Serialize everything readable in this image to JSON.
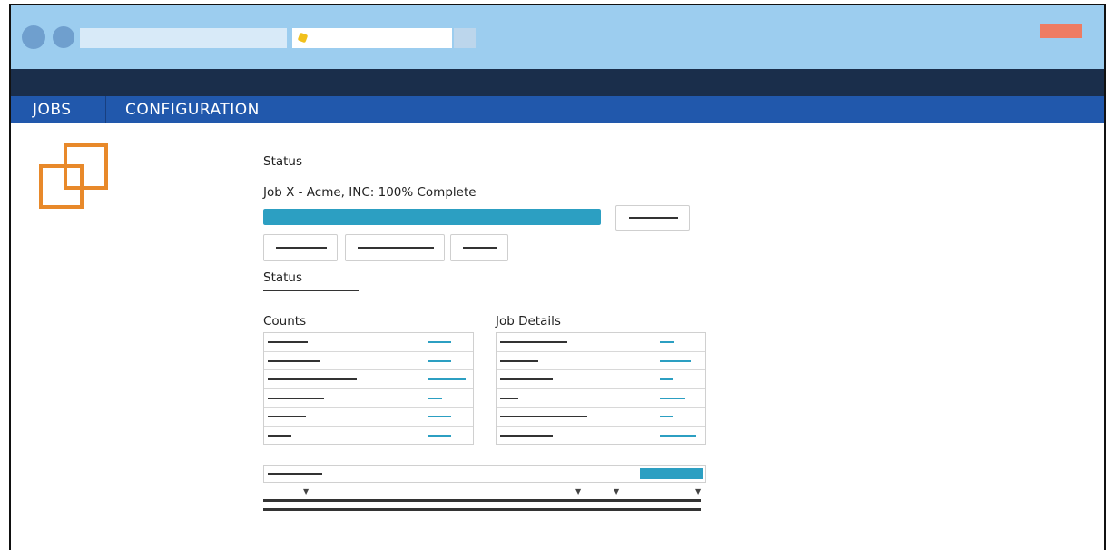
{
  "nav": {
    "items": [
      {
        "label": "JOBS"
      },
      {
        "label": "CONFIGURATION"
      }
    ]
  },
  "colors": {
    "chrome": "#9ccdef",
    "dark_bar": "#1a2e4b",
    "nav": "#2158ac",
    "accent": "#2c9fc2",
    "logo": "#e8892a",
    "close_button": "#ee7c63"
  },
  "main": {
    "status_title": "Status",
    "job_line": "Job X - Acme, INC: 100% Complete",
    "progress_percent": 100,
    "status_heading": "Status",
    "counts_title": "Counts",
    "details_title": "Job Details"
  },
  "icons": {
    "logo": "overlapping-squares-icon",
    "tab": "favicon-icon"
  }
}
